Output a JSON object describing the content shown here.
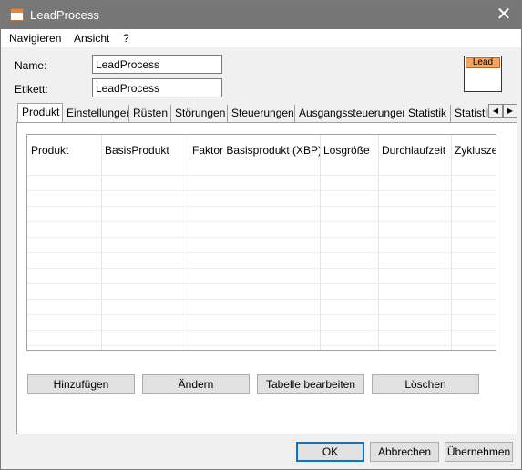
{
  "window": {
    "title": "LeadProcess"
  },
  "menu": {
    "items": [
      "Navigieren",
      "Ansicht",
      "?"
    ]
  },
  "form": {
    "name_label": "Name:",
    "name_value": "LeadProcess",
    "label_label": "Etikett:",
    "label_value": "LeadProcess"
  },
  "object_icon": {
    "label": "Lead"
  },
  "tabs": [
    "Produkt",
    "Einstellungen",
    "Rüsten",
    "Störungen",
    "Steuerungen",
    "Ausgangssteuerungen",
    "Statistik",
    "Statistik"
  ],
  "table": {
    "columns": [
      "Produkt",
      "BasisProdukt",
      "Faktor Basisprodukt (XBP)",
      "Losgröße",
      "Durchlaufzeit",
      "Zykluszeit"
    ]
  },
  "actions": {
    "add": "Hinzufügen",
    "change": "Ändern",
    "edit_table": "Tabelle bearbeiten",
    "delete": "Löschen"
  },
  "dialog": {
    "ok": "OK",
    "cancel": "Abbrechen",
    "apply": "Übernehmen"
  },
  "colors": {
    "titlebar": "#777777",
    "lead_header": "#f4a460",
    "focus": "#0078d7"
  }
}
